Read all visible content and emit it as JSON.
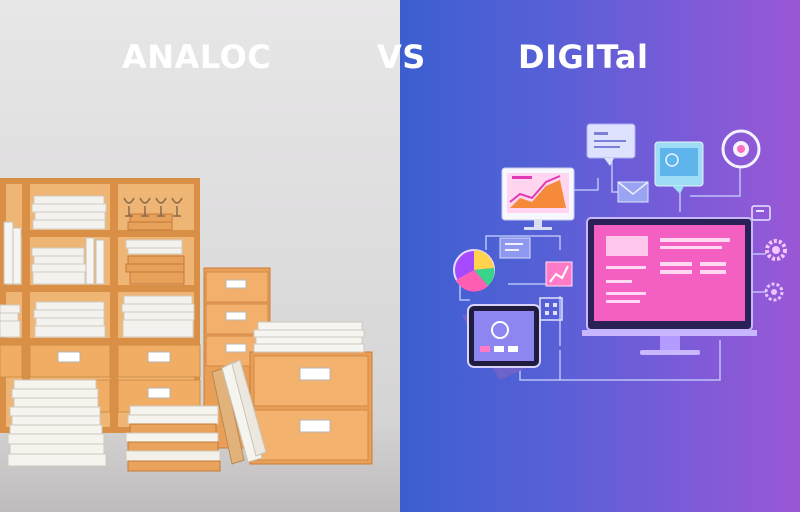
{
  "headings": {
    "analog": "ANALOC",
    "vs": "VS",
    "digital": "DIGITal"
  },
  "colors": {
    "analog_background": "#e0dfe0",
    "digital_background_start": "#3b5fd0",
    "digital_background_end": "#9a58d6",
    "wood": "#e9a760",
    "drawer": "#f0ad63",
    "screen_pink": "#f05fc6",
    "line_color": "#c9d4ff"
  },
  "icons": [
    "bookshelf-icon",
    "file-cabinet-icon",
    "paper-stack-icon",
    "monitor-icon",
    "tablet-icon",
    "chat-bubble-icon",
    "envelope-icon",
    "pie-chart-icon",
    "target-icon",
    "gear-icon"
  ]
}
